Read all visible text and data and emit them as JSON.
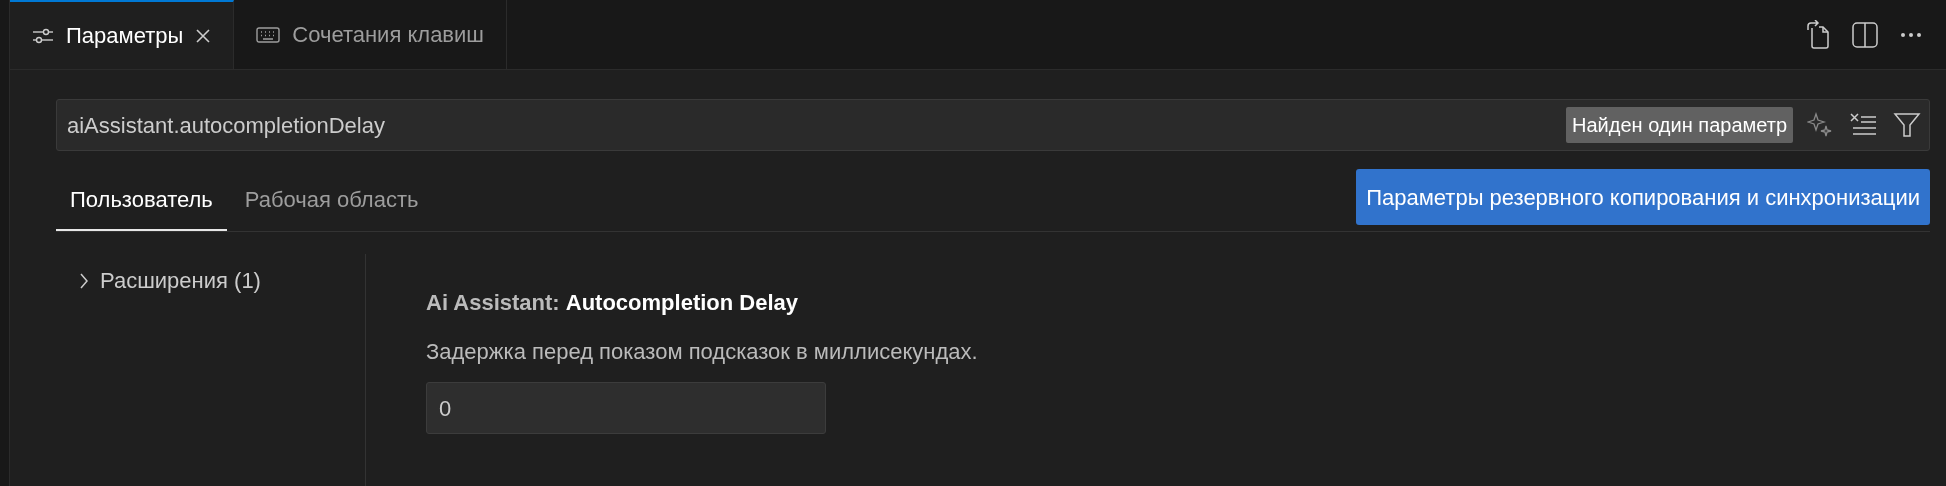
{
  "tabs": [
    {
      "label": "Параметры",
      "kind": "settings",
      "selected": true
    },
    {
      "label": "Сочетания клавиш",
      "kind": "keyboard",
      "selected": false
    }
  ],
  "search": {
    "value": "aiAssistant.autocompletionDelay",
    "result_badge": "Найден один параметр"
  },
  "scope_tabs": [
    {
      "label": "Пользователь",
      "selected": true
    },
    {
      "label": "Рабочая область",
      "selected": false
    }
  ],
  "sync_button": "Параметры резервного копирования и синхронизации",
  "tree": [
    {
      "label": "Расширения (1)",
      "expanded": false
    }
  ],
  "setting": {
    "title": "Ai Assistant: **Autocompletion Delay**",
    "description": "Задержка перед показом подсказок в миллисекундах.",
    "value": "0"
  }
}
